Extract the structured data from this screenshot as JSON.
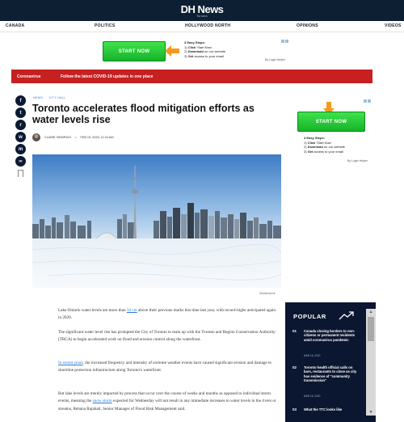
{
  "header": {
    "logo": "DH News",
    "logo_sub": "Toronto"
  },
  "nav": {
    "items": [
      "CANADA",
      "POLITICS",
      "HOLLYWOOD NORTH",
      "OPINIONS",
      "VIDEOS"
    ]
  },
  "ad_top": {
    "button": "START NOW",
    "heading": "3 Easy Steps:",
    "steps": [
      {
        "num": "1)",
        "bold": "Click",
        "rest": " 'Start Now'"
      },
      {
        "num": "2)",
        "bold": "Download",
        "rest": " on our website"
      },
      {
        "num": "3)",
        "bold": "Get",
        "rest": " access to your email"
      }
    ],
    "byline": "By Login Helper"
  },
  "banner": {
    "label": "Coronavirus",
    "text": "Follow the latest COVID-19 updates in one place"
  },
  "share_icons": [
    "facebook-icon",
    "twitter-icon",
    "reddit-icon",
    "whatsapp-icon",
    "messenger-icon",
    "link-icon"
  ],
  "share_glyphs": [
    "f",
    "t",
    "r",
    "w",
    "m",
    "∞"
  ],
  "article": {
    "crumbs": [
      "NEWS",
      "CITY HALL"
    ],
    "headline": "Toronto accelerates flood mitigation efforts as water levels rise",
    "author": "CLAIRE HEINRICH",
    "date": "FEB 19, 2020, 11:24 AM",
    "photo_credit": "Shutterstock",
    "p1": {
      "before": "Lake Ontario water levels are more than ",
      "link": "50 cm",
      "after": " above their previous marks this time last year, with record-highs anticipated again in 2020."
    },
    "p2": "The significant water level rise has prompted the City of Toronto to team up with the Toronto and Region Conservation Authority (TRCA) to begin accelerated work on flood and erosion control along the waterfront.",
    "p3": {
      "link": "In recent years",
      "after": ", the increased frequency and intensity of extreme weather events have caused significant erosion and damage to shoreline protection infrastructure along Toronto's waterfront."
    },
    "p4": {
      "before": "But lake levels are merely impacted by process that occur over the course of weeks and months as opposed to individual storm events, meaning the ",
      "link": "snow storm",
      "after": " expected for Wednesday will not result in any immediate increases to water levels in the rivers or streams, Rehana Rajabali, Senior Manager of Flood Risk Management said."
    }
  },
  "ad_side": {
    "button": "START NOW",
    "heading": "3 Easy Steps:",
    "steps": [
      {
        "num": "1)",
        "bold": "Click",
        "rest": " 'Start Now'"
      },
      {
        "num": "2)",
        "bold": "Download",
        "rest": " on our website"
      },
      {
        "num": "3)",
        "bold": "Get",
        "rest": " access to your email"
      }
    ],
    "byline": "By Login Helper"
  },
  "popular": {
    "title": "POPULAR",
    "items": [
      {
        "num": "01",
        "text": "Canada closing borders to non-citizens or permanent residents amid coronavirus pandemic",
        "date": "MAR 16, 2020"
      },
      {
        "num": "02",
        "text": "Toronto health official calls on bars, restaurants to close as city has evidence of \"community transmission\"",
        "date": "MAR 16, 2020"
      },
      {
        "num": "03",
        "text": "What the TTC looks like",
        "date": ""
      }
    ]
  },
  "colors": {
    "header_bg": "#0d1f33",
    "banner_bg": "#c62020",
    "accent_link": "#2a7ad9",
    "ad_green": "#16b229",
    "ad_arrow": "#f39a1e",
    "popular_bg": "#0b1730"
  }
}
